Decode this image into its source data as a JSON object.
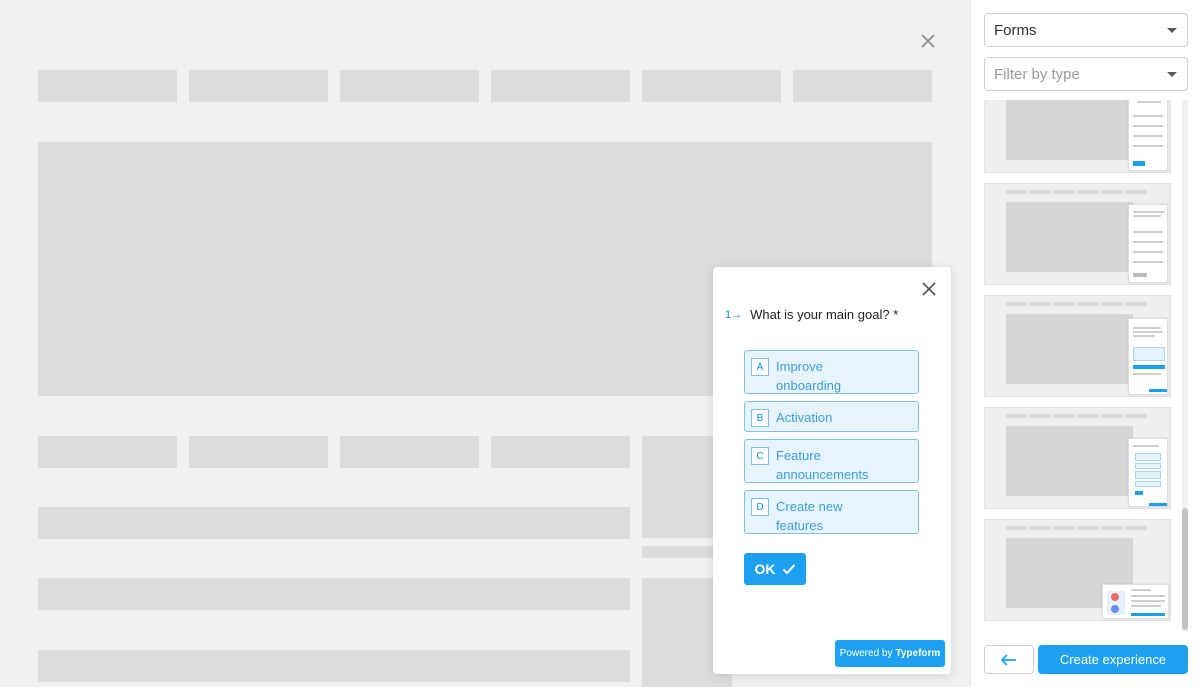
{
  "preview": {
    "close_icon": "close-icon"
  },
  "popup": {
    "question_number": "1",
    "question_text": "What is your main goal? *",
    "options": [
      {
        "key": "A",
        "label": "Improve onboarding"
      },
      {
        "key": "B",
        "label": "Activation"
      },
      {
        "key": "C",
        "label": "Feature announcements"
      },
      {
        "key": "D",
        "label": "Create new features"
      }
    ],
    "ok_label": "OK",
    "powered_by_prefix": "Powered by",
    "powered_by_brand": "Typeform"
  },
  "sidebar": {
    "category_select": "Forms",
    "type_filter_placeholder": "Filter by type",
    "create_label": "Create experience",
    "back_icon": "arrow-left-icon"
  },
  "colors": {
    "accent": "#1da0ef",
    "option_bg": "#e8f4fd",
    "option_border": "#7dc3ee",
    "placeholder": "#dcdcdc"
  }
}
